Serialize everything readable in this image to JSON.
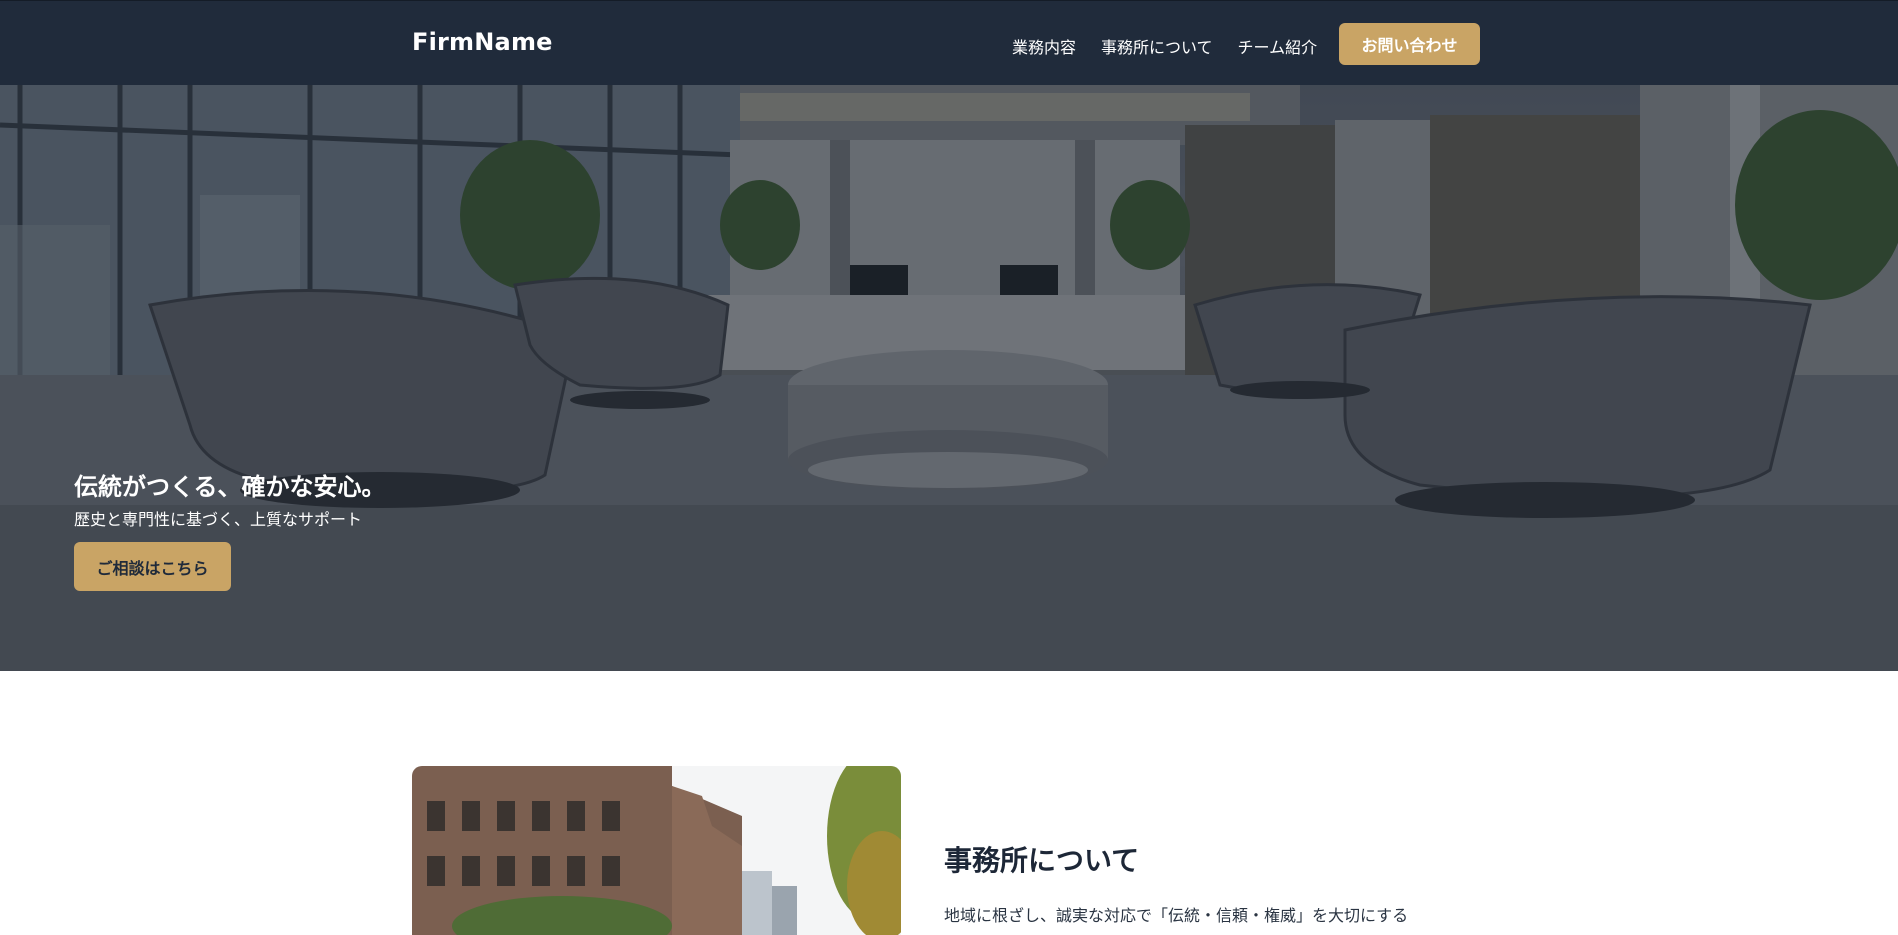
{
  "header": {
    "logo": "FirmName",
    "nav": [
      {
        "label": "業務内容"
      },
      {
        "label": "事務所について"
      },
      {
        "label": "チーム紹介"
      }
    ],
    "cta_label": "お問い合わせ"
  },
  "hero": {
    "title": "伝統がつくる、確かな安心。",
    "subtitle": "歴史と専門性に基づく、上質なサポート",
    "button_label": "ご相談はこちら"
  },
  "about": {
    "title": "事務所について",
    "text": "地域に根ざし、誠実な対応で「伝統・信頼・権威」を大切にする"
  },
  "colors": {
    "header_bg": "#202b3b",
    "accent": "#c9a465",
    "text_dark": "#1d2737"
  }
}
